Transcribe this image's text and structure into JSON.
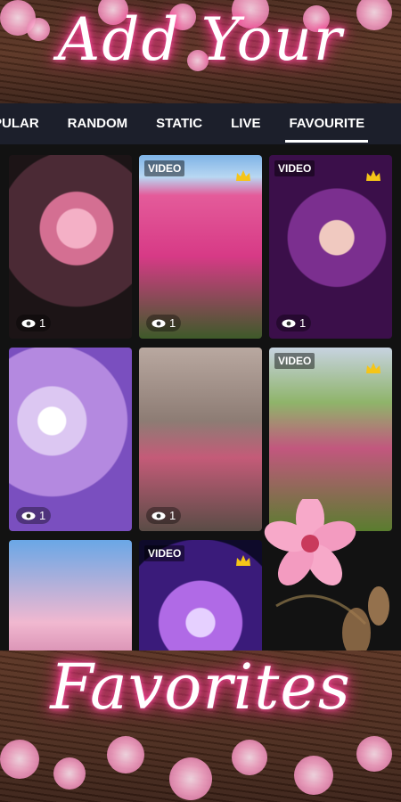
{
  "header": {
    "title": "Add Your"
  },
  "tabs": [
    {
      "label": "PULAR",
      "active": false
    },
    {
      "label": "RANDOM",
      "active": false
    },
    {
      "label": "STATIC",
      "active": false
    },
    {
      "label": "LIVE",
      "active": false
    },
    {
      "label": "FAVOURITE",
      "active": true
    }
  ],
  "cards": [
    {
      "video": "",
      "premium": false,
      "views": "1"
    },
    {
      "video": "VIDEO",
      "premium": true,
      "views": "1"
    },
    {
      "video": "VIDEO",
      "premium": true,
      "views": "1"
    },
    {
      "video": "",
      "premium": false,
      "views": "1"
    },
    {
      "video": "",
      "premium": false,
      "views": "1"
    },
    {
      "video": "VIDEO",
      "premium": true,
      "views": ""
    },
    {
      "video": "",
      "premium": false,
      "views": ""
    },
    {
      "video": "VIDEO",
      "premium": true,
      "views": ""
    }
  ],
  "footer": {
    "title": "Favorites"
  },
  "colors": {
    "tab_bar": "#1c1f2b",
    "glow": "#ff3b93",
    "crown": "#f5c518"
  },
  "icons": {
    "crown": "crown-icon",
    "views": "eye-icon"
  }
}
